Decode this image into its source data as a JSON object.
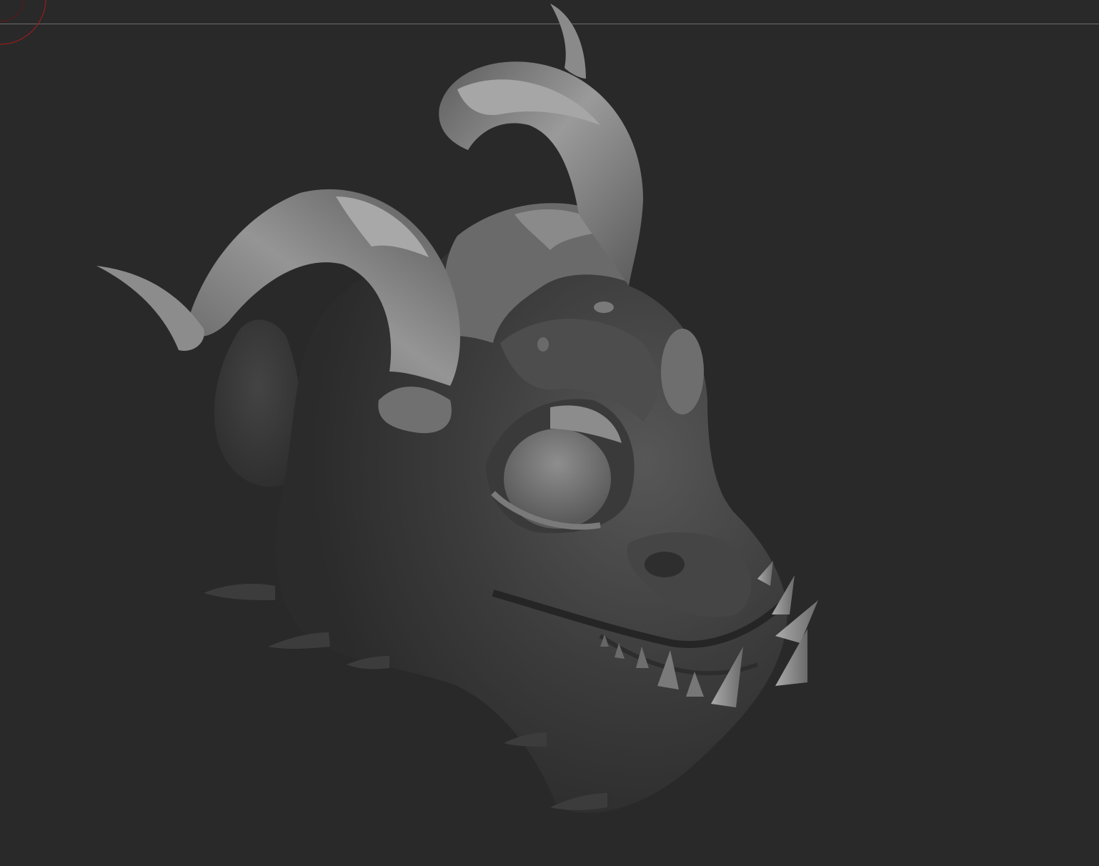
{
  "app": {
    "kind": "3d-sculpting-viewport"
  },
  "viewport": {
    "background_color": "#292929",
    "frame_line_color": "#6e6e6e",
    "gizmo_color": "#9b1b1b"
  },
  "model": {
    "icon": "horned-demon-head-sculpt",
    "material": "matcap-gray",
    "base_color": "#3a3a3a",
    "highlight_color": "#8c8c8c",
    "horn_color": "#7a7a7a"
  }
}
